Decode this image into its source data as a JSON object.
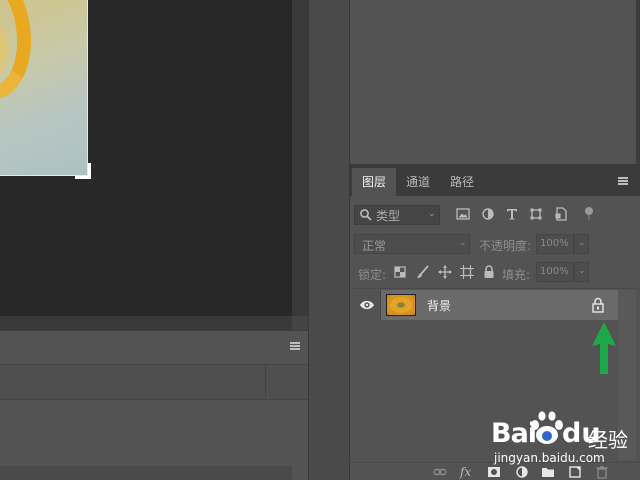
{
  "layers_panel": {
    "tabs": [
      {
        "label": "图层",
        "active": true
      },
      {
        "label": "通道",
        "active": false
      },
      {
        "label": "路径",
        "active": false
      }
    ],
    "filter": {
      "kind_label": "类型"
    },
    "blend_mode": "正常",
    "opacity_label": "不透明度:",
    "opacity_value": "100%",
    "lock_label": "锁定:",
    "fill_label": "填充:",
    "fill_value": "100%",
    "layers": [
      {
        "name": "背景",
        "visible": true,
        "locked": true
      }
    ],
    "footer_fx": "fx"
  },
  "annotation": {
    "arrow_color": "#1fa84a"
  },
  "watermark": {
    "brand_latin": "Bai",
    "brand_du": "du",
    "brand_cn": "经验",
    "url": "jingyan.baidu.com"
  },
  "colors": {
    "panel_bg": "#535353",
    "canvas_bg": "#282828",
    "selected_layer": "#6a6a6a"
  }
}
